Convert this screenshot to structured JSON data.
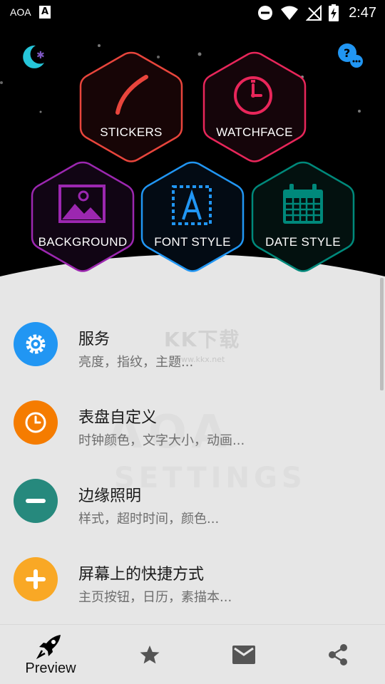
{
  "status_bar": {
    "carrier": "AOA",
    "time": "2:47"
  },
  "hero": {
    "items": [
      {
        "label": "STICKERS",
        "color": "#e8453c",
        "icon": "stickers-arc-icon"
      },
      {
        "label": "WATCHFACE",
        "color": "#e8265a",
        "icon": "clock-icon"
      },
      {
        "label": "BACKGROUND",
        "color": "#9c27b0",
        "icon": "image-icon"
      },
      {
        "label": "FONT STYLE",
        "color": "#2196f3",
        "icon": "font-icon"
      },
      {
        "label": "DATE STYLE",
        "color": "#00897b",
        "icon": "calendar-icon"
      }
    ],
    "logo_icon": "moon-logo-icon",
    "help_icon": "help-chat-icon"
  },
  "menu": {
    "items": [
      {
        "title": "服务",
        "subtitle": "亮度，指纹，主题...",
        "color": "#2196f3",
        "icon": "gear-icon"
      },
      {
        "title": "表盘自定义",
        "subtitle": "时钟颜色，文字大小，动画...",
        "color": "#f57c00",
        "icon": "clock-icon"
      },
      {
        "title": "边缘照明",
        "subtitle": "样式，超时时间，颜色...",
        "color": "#26897d",
        "icon": "minus-icon"
      },
      {
        "title": "屏幕上的快捷方式",
        "subtitle": "主页按钮，日历，素描本...",
        "color": "#f9a825",
        "icon": "plus-icon"
      }
    ]
  },
  "watermark": {
    "line1": "KK下载",
    "line2": "www.kkx.net",
    "line3": "AOA",
    "line4": "SETTINGS"
  },
  "bottom_nav": {
    "items": [
      {
        "label": "Preview",
        "icon": "rocket-icon"
      },
      {
        "label": "",
        "icon": "star-icon"
      },
      {
        "label": "",
        "icon": "mail-icon"
      },
      {
        "label": "",
        "icon": "share-icon"
      }
    ]
  }
}
